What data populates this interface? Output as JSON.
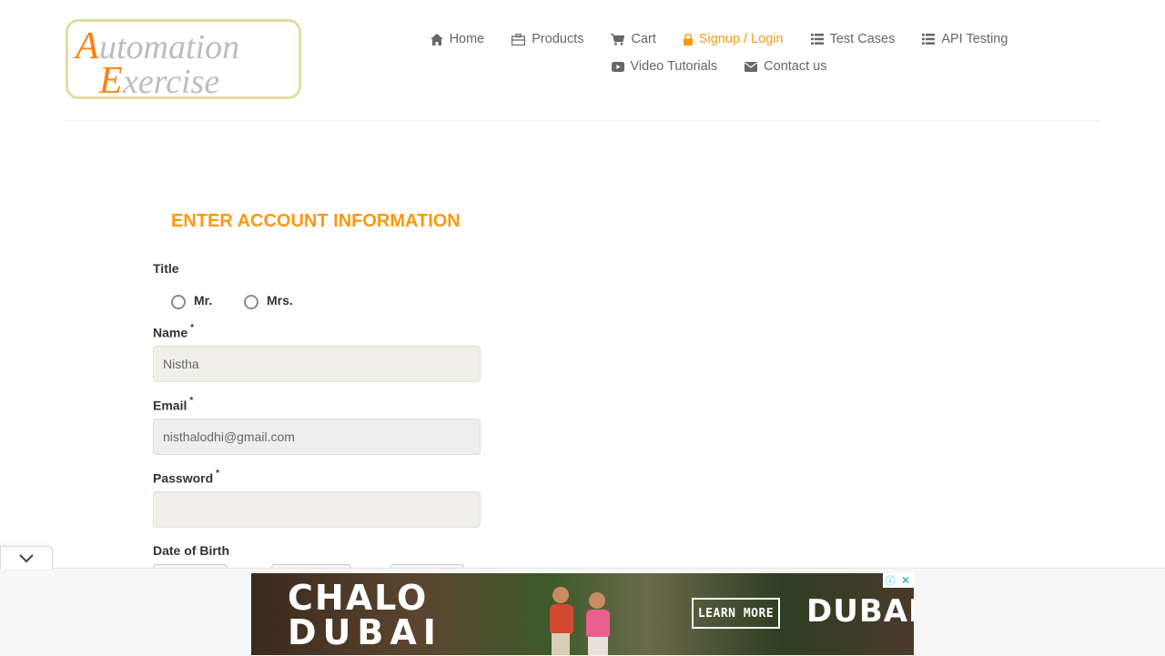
{
  "logo": {
    "line1": "Automation",
    "line2": "Exercise"
  },
  "nav": {
    "row1": [
      {
        "label": "Home",
        "icon": "home-icon"
      },
      {
        "label": "Products",
        "icon": "briefcase-icon"
      },
      {
        "label": "Cart",
        "icon": "cart-icon"
      },
      {
        "label": "Signup / Login",
        "icon": "lock-icon",
        "active": true
      },
      {
        "label": "Test Cases",
        "icon": "list-icon"
      },
      {
        "label": "API Testing",
        "icon": "list-icon"
      }
    ],
    "row2": [
      {
        "label": "Video Tutorials",
        "icon": "youtube-icon"
      },
      {
        "label": "Contact us",
        "icon": "envelope-icon"
      }
    ]
  },
  "form": {
    "title": "ENTER ACCOUNT INFORMATION",
    "title_label": "Title",
    "title_options": [
      "Mr.",
      "Mrs."
    ],
    "name_label": "Name",
    "name_value": "Nistha",
    "email_label": "Email",
    "email_value": "nisthalodhi@gmail.com",
    "password_label": "Password",
    "password_value": "",
    "required_mark": "*",
    "dob_label": "Date of Birth"
  },
  "ad": {
    "headline_line1": "CHALO",
    "headline_line2": "DUBAI",
    "cta": "LEARN MORE",
    "brand": "DUBAI",
    "close": "✕",
    "info": "ⓘ"
  },
  "colors": {
    "accent": "#FE980F",
    "text": "#696763",
    "input_bg": "#f0f0e9"
  }
}
